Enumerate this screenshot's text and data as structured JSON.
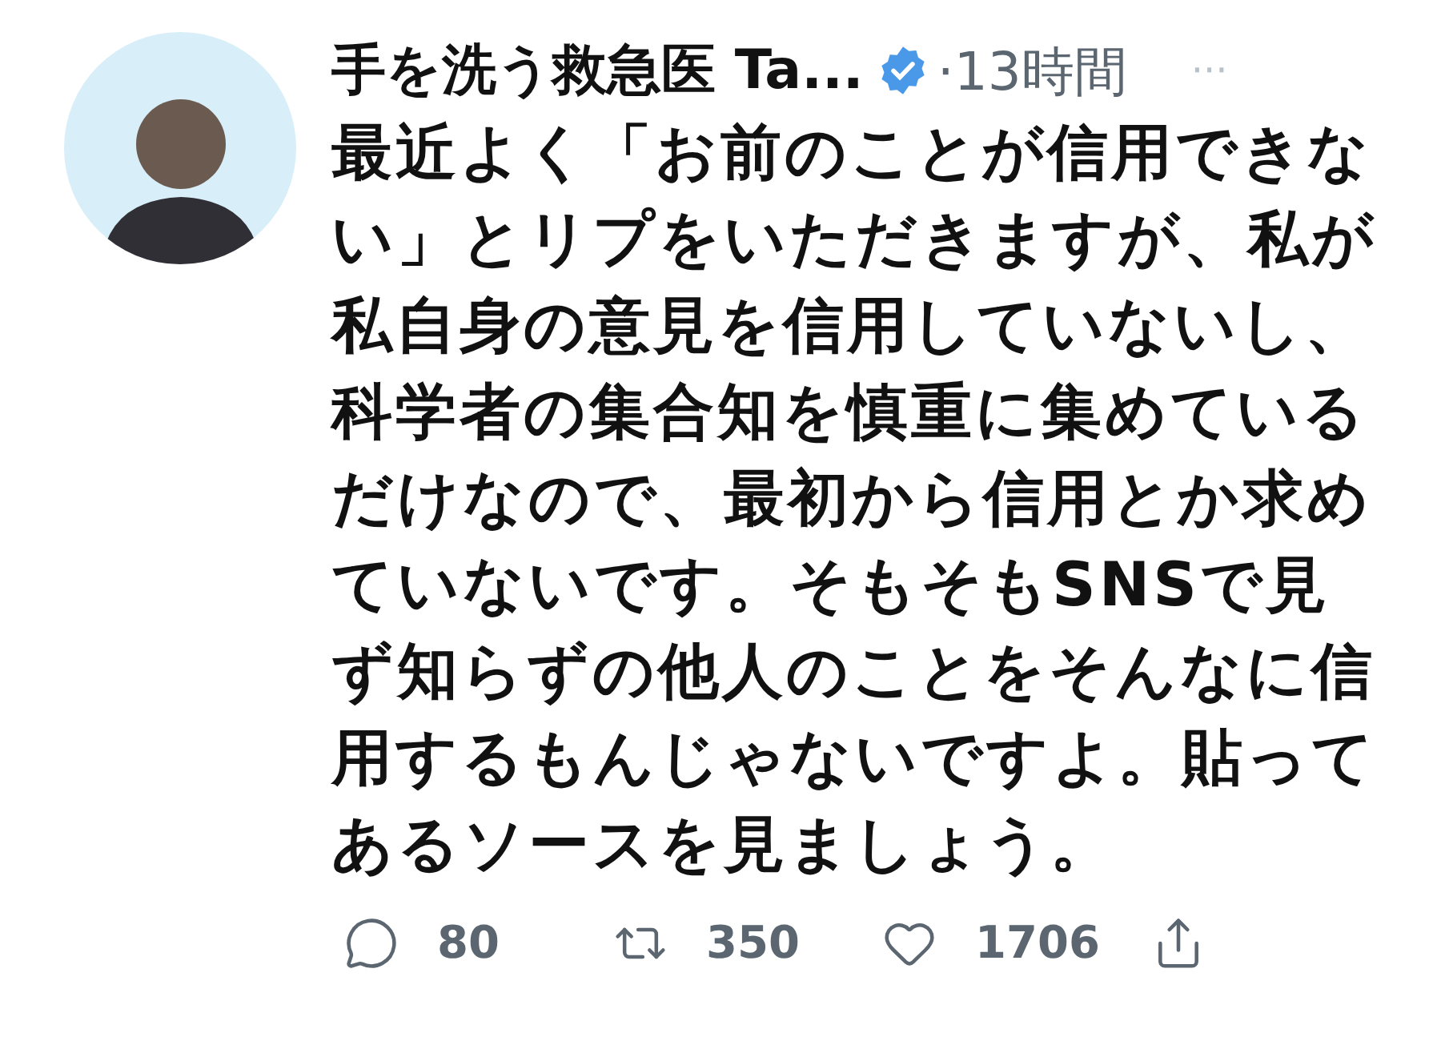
{
  "tweet": {
    "author_name": "手を洗う救急医 Ta...",
    "verified": true,
    "time": "·13時間",
    "more": "···",
    "text": "最近よく「お前のことが信用できない」とリプをいただきますが、私が私自身の意見を信用していないし、科学者の集合知を慎重に集めているだけなので、最初から信用とか求めていないです。そもそもSNSで見ず知らずの他人のことをそんなに信用するもんじゃないですよ。貼ってあるソースを見ましょう。",
    "actions": [
      {
        "kind": "reply",
        "count": "80"
      },
      {
        "kind": "retweet",
        "count": "350"
      },
      {
        "kind": "like",
        "count": "1706"
      },
      {
        "kind": "share"
      }
    ]
  }
}
